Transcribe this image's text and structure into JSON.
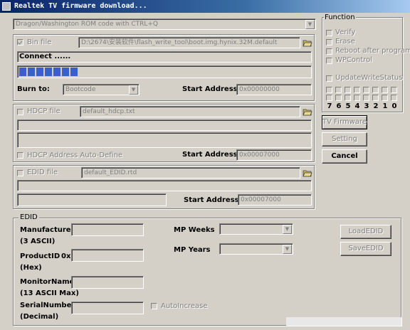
{
  "window": {
    "title": "Realtek TV firmware download..."
  },
  "top": {
    "mode_select": "Dragon/Washington ROM code with CTRL+Q",
    "bin_file_label": "Bin file",
    "bin_file_path": "D:\\2674\\安装软件\\flash_write_tool\\boot.img.hynix.32M.default",
    "status_text": "Connect ......",
    "progress": 0.15,
    "burn_to_label": "Burn to:",
    "burn_to_value": "Bootcode",
    "start_address_label": "Start Address:",
    "start_address_value": "0x00000000"
  },
  "hdcp": {
    "file_label": "HDCP file",
    "file_path": "default_hdcp.txt",
    "auto_define_label": "HDCP Address Auto-Define",
    "start_address_label": "Start Address:",
    "start_address_value": "0x00007000"
  },
  "edid_file": {
    "file_label": "EDID file",
    "file_path": "default_EDID.rtd",
    "start_address_label": "Start Address:",
    "start_address_value": "0x00007000"
  },
  "function": {
    "group_label": "Function",
    "options": [
      "Verify",
      "Erase",
      "Reboot after program",
      "WPControl"
    ],
    "update_write_status": "UpdateWriteStatus",
    "bits": [
      "7",
      "6",
      "5",
      "4",
      "3",
      "2",
      "1",
      "0"
    ]
  },
  "buttons": {
    "tv_firmware": "TV Firmware",
    "setting": "Setting",
    "cancel": "Cancel"
  },
  "edid": {
    "group_label": "EDID",
    "manufacture_id": "ManufactureID",
    "manufacture_id_sub": "(3 ASCII)",
    "product_id": "ProductID",
    "product_id_prefix": "0x",
    "product_id_sub": "(Hex)",
    "monitor_name": "MonitorName",
    "monitor_name_sub": "(13 ASCII Max)",
    "serial_number": "SerialNumber",
    "serial_number_sub": "(Decimal)",
    "mp_weeks": "MP Weeks",
    "mp_years": "MP Years",
    "auto_increase": "AutoIncrease",
    "load_edid": "LoadEDID",
    "save_edid": "SaveEDID"
  }
}
